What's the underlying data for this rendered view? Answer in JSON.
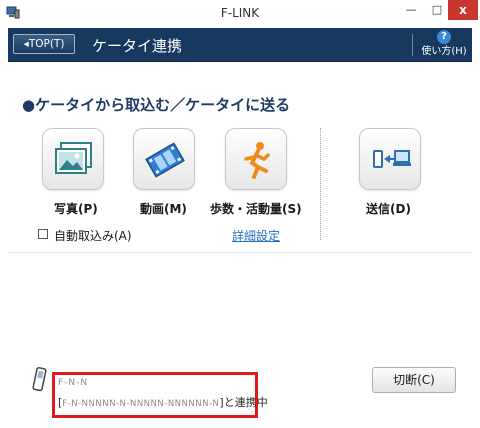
{
  "window": {
    "title": "F-LINK",
    "close_glyph": "x",
    "min_glyph": "—",
    "max_glyph": "□"
  },
  "header": {
    "top_button": "◂TOP(T)",
    "title": "ケータイ連携",
    "help_label": "使い方(H)",
    "help_icon_glyph": "?"
  },
  "section": {
    "title": "●ケータイから取込む／ケータイに送る"
  },
  "actions": {
    "photo": {
      "label": "写真(P)",
      "icon": "photo-icon"
    },
    "video": {
      "label": "動画(M)",
      "icon": "film-icon"
    },
    "pedometer": {
      "label": "歩数・活動量(S)",
      "icon": "runner-icon"
    },
    "send": {
      "label": "送信(D)",
      "icon": "phone-to-pc-icon"
    }
  },
  "auto_import": {
    "label": "自動取込み(A)",
    "checked": false
  },
  "detail_link": "詳細設定",
  "status": {
    "device_name": "F-N-N",
    "device_id_blur": "F-N-NNNNN-N-NNNNN-NNNNNN-N",
    "device_id_open": "[",
    "device_id_close": "]と連携中"
  },
  "disconnect_button": "切断(C)",
  "colors": {
    "header_bg": "#17395f",
    "highlight": "#e0191b",
    "link": "#1f6fbf",
    "close_btn": "#c7372f"
  }
}
